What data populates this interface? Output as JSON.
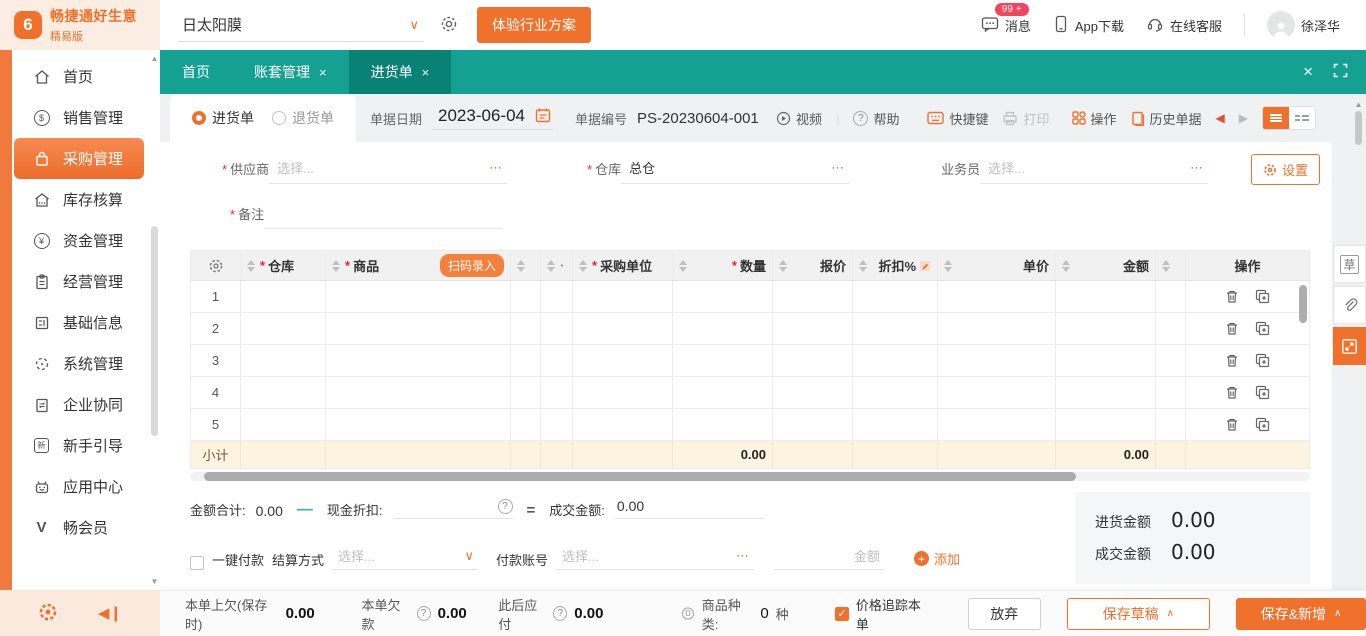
{
  "header": {
    "brand": {
      "logo_glyph": "6",
      "name": "畅捷通好生意",
      "edition": "精易版"
    },
    "company_select": {
      "value": "日太阳膜"
    },
    "cta_button": "体验行业方案",
    "right": {
      "messages": "消息",
      "messages_badge": "99 +",
      "app_download": "App下载",
      "online_service": "在线客服",
      "username": "徐泽华"
    }
  },
  "sidebar": {
    "items": [
      {
        "label": "首页"
      },
      {
        "label": "销售管理",
        "glyph": "$"
      },
      {
        "label": "采购管理"
      },
      {
        "label": "库存核算"
      },
      {
        "label": "资金管理",
        "glyph": "¥"
      },
      {
        "label": "经营管理"
      },
      {
        "label": "基础信息"
      },
      {
        "label": "系统管理"
      },
      {
        "label": "企业协同"
      },
      {
        "label": "新手引导",
        "glyph": "新"
      },
      {
        "label": "应用中心"
      },
      {
        "label": "畅会员",
        "glyph": "V"
      }
    ]
  },
  "tabs": {
    "items": [
      {
        "label": "首页"
      },
      {
        "label": "账套管理"
      },
      {
        "label": "进货单"
      }
    ]
  },
  "toolbar": {
    "doc_type_in": "进货单",
    "doc_type_out": "退货单",
    "date_label": "单据日期",
    "date_value": "2023-06-04",
    "no_label": "单据编号",
    "no_value": "PS-20230604-001",
    "video": "视频",
    "help": "帮助",
    "hotkeys": "快捷键",
    "print": "打印",
    "actions": "操作",
    "history": "历史单据"
  },
  "form": {
    "supplier_label": "供应商",
    "supplier_placeholder": "选择...",
    "warehouse_label": "仓库",
    "warehouse_value": "总仓",
    "salesman_label": "业务员",
    "salesman_placeholder": "选择...",
    "remark_label": "备注",
    "settings_button": "设置"
  },
  "table": {
    "scan_button": "扫码录入",
    "columns": [
      {
        "label": ""
      },
      {
        "label": "仓库"
      },
      {
        "label": "商品"
      },
      {
        "label": ""
      },
      {
        "label": "·"
      },
      {
        "label": "采购单位"
      },
      {
        "label": "数量"
      },
      {
        "label": "报价"
      },
      {
        "label": "折扣%"
      },
      {
        "label": "单价"
      },
      {
        "label": "金额"
      },
      {
        "label": ""
      },
      {
        "label": "操作"
      }
    ],
    "rows": [
      "1",
      "2",
      "3",
      "4",
      "5"
    ],
    "subtotal": {
      "label": "小计",
      "qty": "0.00",
      "amount": "0.00"
    }
  },
  "summary": {
    "total_label": "金额合计:",
    "total_value": "0.00",
    "cash_discount_label": "现金折扣:",
    "deal_label": "成交金额:",
    "deal_value": "0.00"
  },
  "payment": {
    "one_click_label": "一键付款",
    "settle_label": "结算方式",
    "settle_placeholder": "选择...",
    "account_label": "付款账号",
    "account_placeholder": "选择...",
    "amount_placeholder": "金额",
    "add_label": "添加"
  },
  "totals_panel": {
    "purchase_label": "进货金额",
    "purchase_value": "0.00",
    "deal_label": "成交金额",
    "deal_value": "0.00"
  },
  "footer_bar": {
    "owed_label": "本单上欠(保存时)",
    "owed_value": "0.00",
    "debt_label": "本单欠款",
    "debt_value": "0.00",
    "payable_label": "此后应付",
    "payable_value": "0.00",
    "sku_label": "商品种类:",
    "sku_value": "0",
    "sku_unit": "种",
    "price_track_label": "价格追踪本单",
    "discard_button": "放弃",
    "save_draft_button": "保存草稿",
    "save_new_button": "保存&新增"
  },
  "icons": {
    "required": "*",
    "more": "⋯",
    "chevron_down": "∨",
    "close": "×",
    "prev": "◀",
    "next": "▶",
    "caret_up": "∧",
    "minus": "—",
    "equals": "=",
    "question": "?",
    "check": "✓",
    "draft_glyph": "草",
    "scroll_up": "▲",
    "scroll_down": "▼",
    "collapse": "◀❙"
  },
  "colors": {
    "accent_orange": "#F0712C",
    "teal_bar": "#14A191",
    "teal_active_tab": "#078275",
    "badge_red": "#F5455C",
    "subtotal_bg": "#FCF4E1"
  }
}
